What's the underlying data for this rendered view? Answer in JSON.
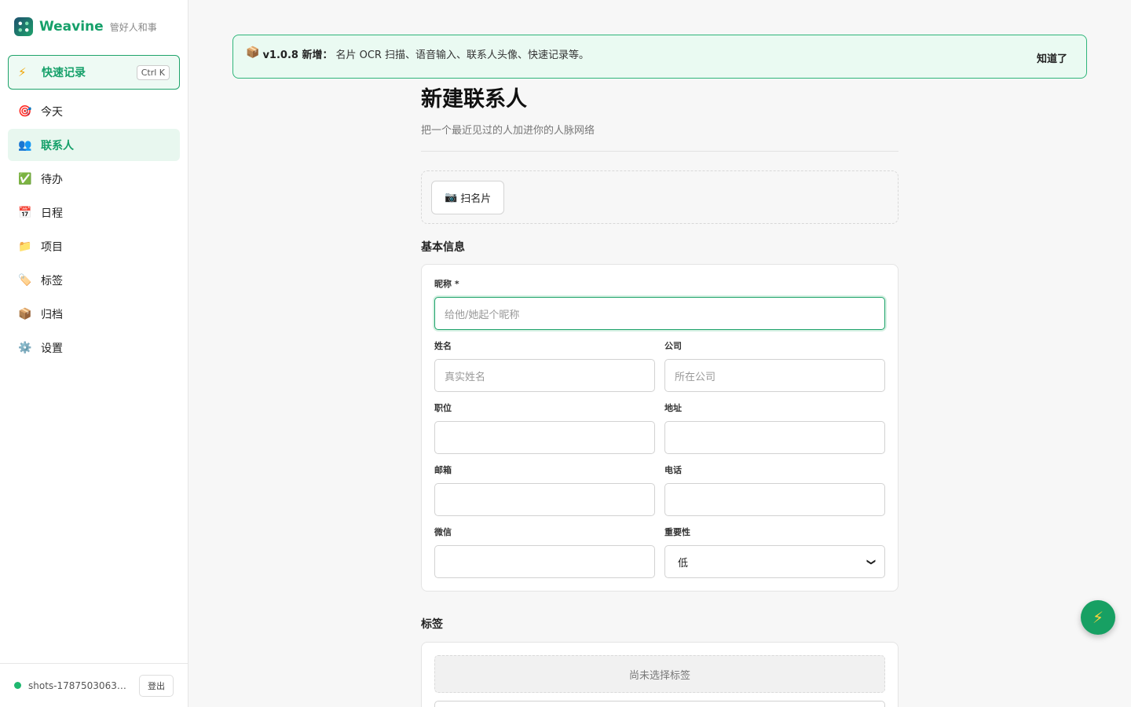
{
  "brand": {
    "name": "Weavine",
    "tagline": "管好人和事"
  },
  "quick_record": {
    "icon": "lightning-icon",
    "label": "快速记录",
    "shortcut": "Ctrl K"
  },
  "nav": [
    {
      "icon": "target-icon",
      "glyph": "🎯",
      "label": "今天",
      "active": false
    },
    {
      "icon": "people-icon",
      "glyph": "👥",
      "label": "联系人",
      "active": true
    },
    {
      "icon": "checkmark-icon",
      "glyph": "✅",
      "label": "待办",
      "active": false
    },
    {
      "icon": "calendar-icon",
      "glyph": "📅",
      "label": "日程",
      "active": false
    },
    {
      "icon": "folder-icon",
      "glyph": "📁",
      "label": "项目",
      "active": false
    },
    {
      "icon": "tag-icon",
      "glyph": "🏷️",
      "label": "标签",
      "active": false
    },
    {
      "icon": "archive-box-icon",
      "glyph": "📦",
      "label": "归档",
      "active": false
    },
    {
      "icon": "gear-icon",
      "glyph": "⚙️",
      "label": "设置",
      "active": false
    }
  ],
  "footer": {
    "user": "shots-1787503063794…",
    "logout": "登出"
  },
  "banner": {
    "icon": "package-icon",
    "version_label": "v1.0.8 新增：",
    "message": "名片 OCR 扫描、语音输入、联系人头像、快速记录等。",
    "dismiss": "知道了"
  },
  "page": {
    "title": "新建联系人",
    "subtitle": "把一个最近见过的人加进你的人脉网络"
  },
  "scan": {
    "icon": "camera-icon",
    "label": "扫名片"
  },
  "basic": {
    "section_title": "基本信息",
    "nickname": {
      "label": "昵称 *",
      "placeholder": "给他/她起个昵称"
    },
    "name": {
      "label": "姓名",
      "placeholder": "真实姓名"
    },
    "company": {
      "label": "公司",
      "placeholder": "所在公司"
    },
    "title": {
      "label": "职位",
      "placeholder": ""
    },
    "address": {
      "label": "地址",
      "placeholder": ""
    },
    "email": {
      "label": "邮箱",
      "placeholder": ""
    },
    "phone": {
      "label": "电话",
      "placeholder": ""
    },
    "wechat": {
      "label": "微信",
      "placeholder": ""
    },
    "importance": {
      "label": "重要性",
      "value": "低"
    }
  },
  "tags": {
    "section_title": "标签",
    "empty_text": "尚未选择标签"
  },
  "fab": {
    "icon": "lightning-icon"
  },
  "colors": {
    "accent": "#1fa36b",
    "banner_bg": "#eafaf2",
    "fab": "#17a063"
  }
}
